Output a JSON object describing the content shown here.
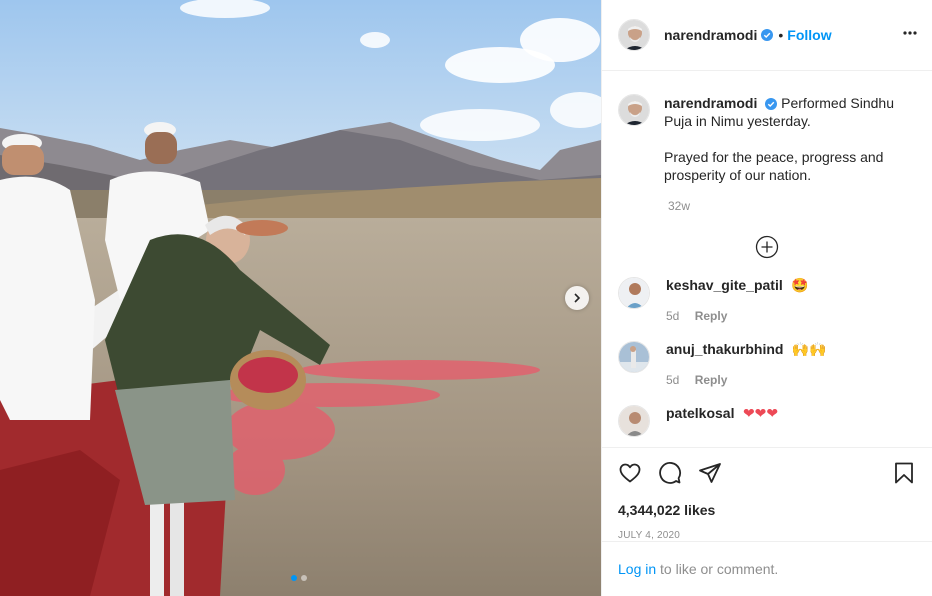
{
  "post": {
    "username": "narendramodi",
    "follow_label": "Follow",
    "bullet": "•",
    "more_icon": "more-options-icon",
    "verified_color": "#0095f6"
  },
  "caption": {
    "username": "narendramodi",
    "line1": "Performed Sindhu Puja in Nimu yesterday.",
    "line2": "Prayed for the peace, progress and prosperity of our nation.",
    "age": "32w"
  },
  "comments": [
    {
      "username": "keshav_gite_patil",
      "emoji": "🤩",
      "age": "5d",
      "reply": "Reply"
    },
    {
      "username": "anuj_thakurbhind",
      "emoji": "🙌🙌",
      "age": "5d",
      "reply": "Reply"
    },
    {
      "username": "patelkosal",
      "emoji": "❤❤❤",
      "age": "",
      "reply": ""
    }
  ],
  "stats": {
    "likes": "4,344,022 likes",
    "date": "JULY 4, 2020"
  },
  "footer": {
    "login_link": "Log in",
    "login_text": " to like or comment."
  },
  "colors": {
    "accent": "#0095f6",
    "muted": "#8e8e8e",
    "border": "#efefef"
  }
}
